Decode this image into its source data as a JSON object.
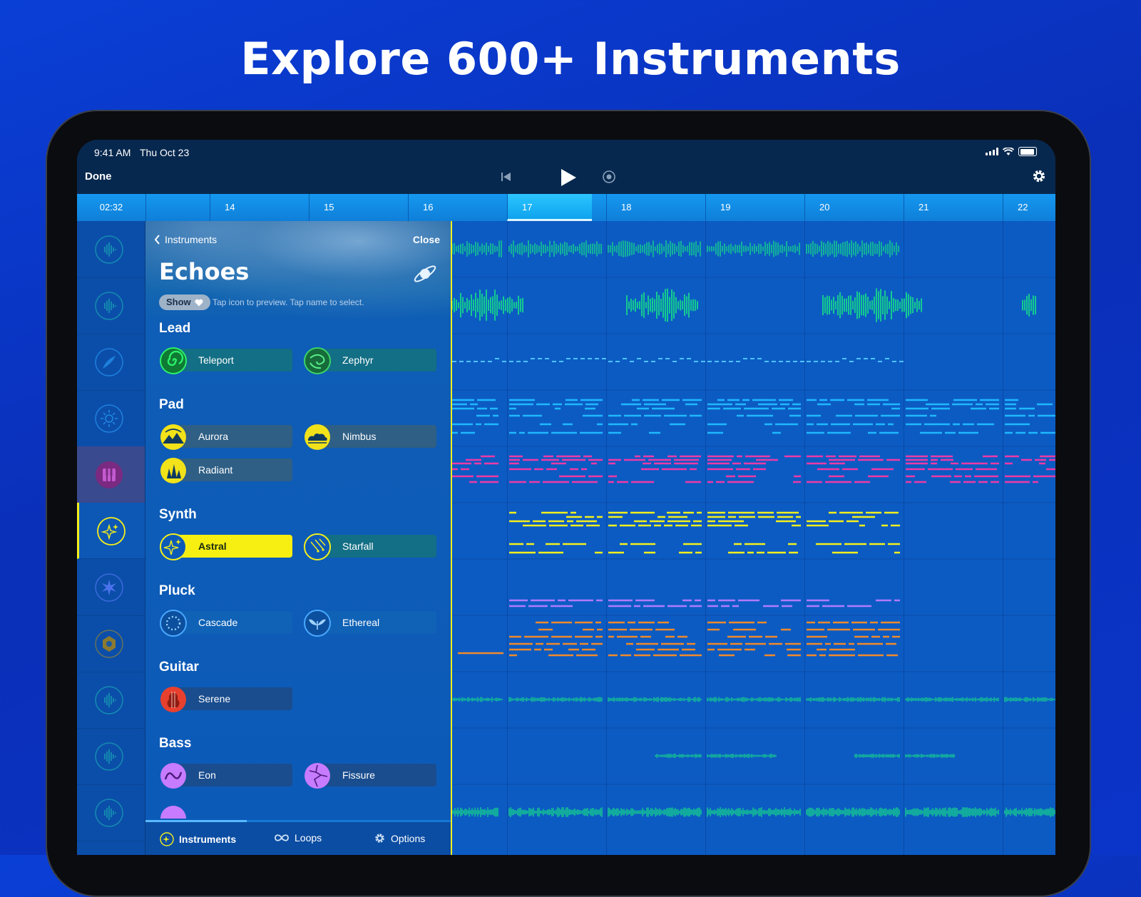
{
  "headline": "Explore 600+ Instruments",
  "status": {
    "time": "9:41 AM",
    "date": "Thu Oct 23"
  },
  "toolbar": {
    "done": "Done"
  },
  "ruler": {
    "timecode": "02:32",
    "bars": [
      "14",
      "15",
      "16",
      "17",
      "18",
      "19",
      "20",
      "21",
      "22"
    ],
    "current": "17"
  },
  "panel": {
    "back": "Instruments",
    "close": "Close",
    "title": "Echoes",
    "show": "Show",
    "hint": "Tap icon to preview. Tap name to select.",
    "categories": [
      "Lead",
      "Pad",
      "Synth",
      "Pluck",
      "Guitar",
      "Bass"
    ],
    "instruments": {
      "teleport": "Teleport",
      "zephyr": "Zephyr",
      "aurora": "Aurora",
      "nimbus": "Nimbus",
      "radiant": "Radiant",
      "astral": "Astral",
      "starfall": "Starfall",
      "cascade": "Cascade",
      "ethereal": "Ethereal",
      "serene": "Serene",
      "eon": "Eon",
      "fissure": "Fissure"
    },
    "selected": "Astral",
    "tabs": {
      "instruments": "Instruments",
      "loops": "Loops",
      "options": "Options"
    }
  },
  "colors": {
    "accent": "#f4ef1c",
    "lead": "#16d68a",
    "pad_cyan": "#1fb8ff",
    "pad_pink": "#ee3aa6",
    "synth": "#f4ef1c",
    "pluck": "#b07bff",
    "arp": "#f08a2a"
  }
}
